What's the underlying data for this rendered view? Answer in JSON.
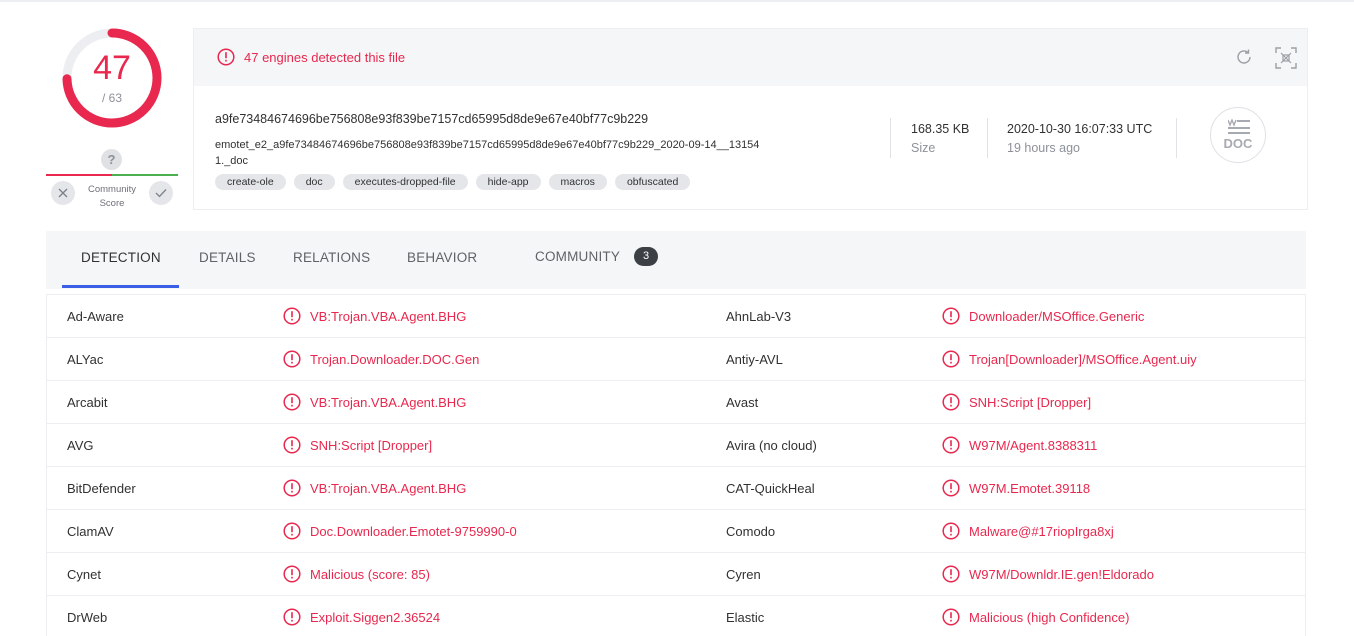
{
  "score": {
    "detected": "47",
    "total": "/ 63",
    "ratio": 0.746
  },
  "community": {
    "question": "?",
    "label_line1": "Community",
    "label_line2": "Score"
  },
  "header": {
    "alert": "47 engines detected this file"
  },
  "file": {
    "hash": "a9fe73484674696be756808e93f839be7157cd65995d8de9e67e40bf77c9b229",
    "name_line1": "emotet_e2_a9fe73484674696be756808e93f839be7157cd65995d8de9e67e40bf77c9b229_2020-09-14__13154",
    "name_line2": "1._doc",
    "tags": [
      "create-ole",
      "doc",
      "executes-dropped-file",
      "hide-app",
      "macros",
      "obfuscated"
    ],
    "size": "168.35 KB",
    "size_label": "Size",
    "date": "2020-10-30 16:07:33 UTC",
    "date_ago": "19 hours ago",
    "type": "DOC"
  },
  "tabs": [
    {
      "label": "DETECTION"
    },
    {
      "label": "DETAILS"
    },
    {
      "label": "RELATIONS"
    },
    {
      "label": "BEHAVIOR"
    },
    {
      "label": "COMMUNITY"
    }
  ],
  "community_count": "3",
  "detections": [
    {
      "engine1": "Ad-Aware",
      "result1": "VB:Trojan.VBA.Agent.BHG",
      "engine2": "AhnLab-V3",
      "result2": "Downloader/MSOffice.Generic"
    },
    {
      "engine1": "ALYac",
      "result1": "Trojan.Downloader.DOC.Gen",
      "engine2": "Antiy-AVL",
      "result2": "Trojan[Downloader]/MSOffice.Agent.uiy"
    },
    {
      "engine1": "Arcabit",
      "result1": "VB:Trojan.VBA.Agent.BHG",
      "engine2": "Avast",
      "result2": "SNH:Script [Dropper]"
    },
    {
      "engine1": "AVG",
      "result1": "SNH:Script [Dropper]",
      "engine2": "Avira (no cloud)",
      "result2": "W97M/Agent.8388311"
    },
    {
      "engine1": "BitDefender",
      "result1": "VB:Trojan.VBA.Agent.BHG",
      "engine2": "CAT-QuickHeal",
      "result2": "W97M.Emotet.39118"
    },
    {
      "engine1": "ClamAV",
      "result1": "Doc.Downloader.Emotet-9759990-0",
      "engine2": "Comodo",
      "result2": "Malware@#17riopIrga8xj"
    },
    {
      "engine1": "Cynet",
      "result1": "Malicious (score: 85)",
      "engine2": "Cyren",
      "result2": "W97M/Downldr.IE.gen!Eldorado"
    },
    {
      "engine1": "DrWeb",
      "result1": "Exploit.Siggen2.36524",
      "engine2": "Elastic",
      "result2": "Malicious (high Confidence)"
    }
  ],
  "colors": {
    "malicious": "#e8284e",
    "accent": "#3b5ee6",
    "harmless": "#4caf50"
  }
}
